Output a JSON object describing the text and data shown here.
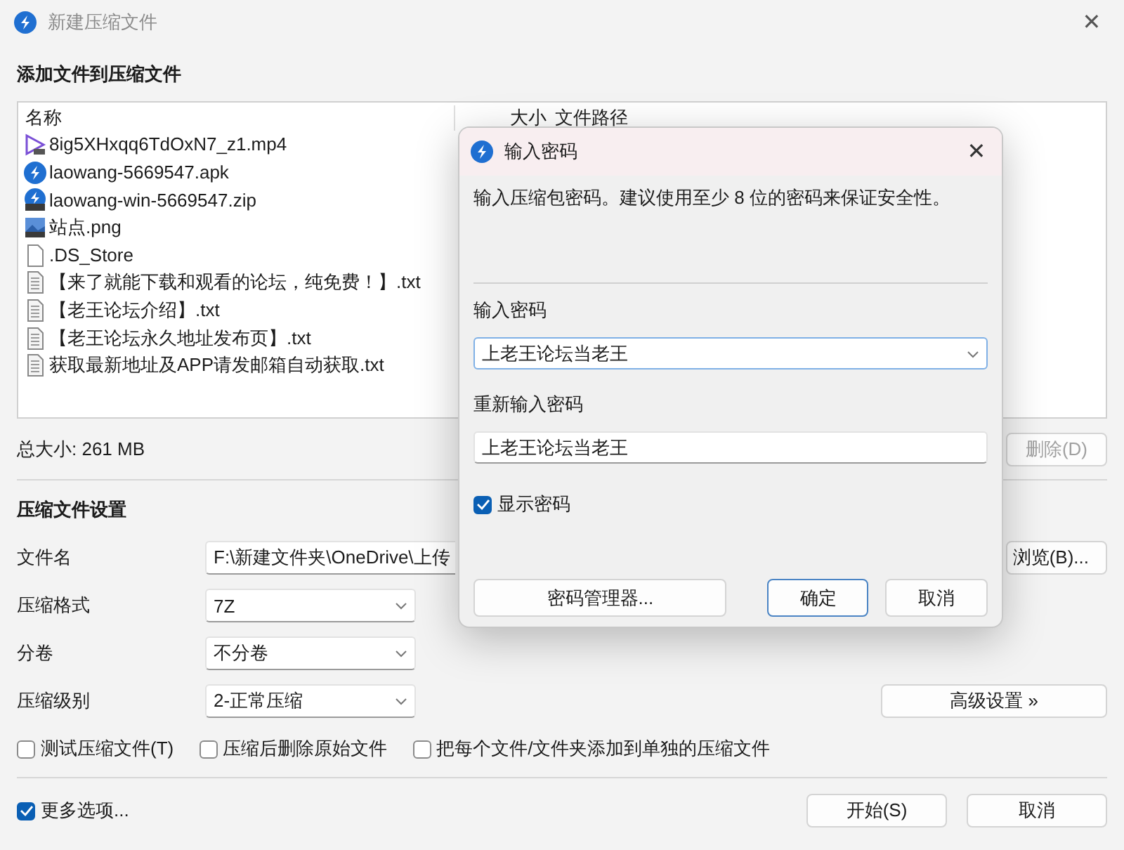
{
  "window": {
    "title": "新建压缩文件",
    "close": "✕"
  },
  "add_section": {
    "heading": "添加文件到压缩文件"
  },
  "file_list": {
    "columns": [
      "名称",
      "大小",
      "文件路径"
    ],
    "rows": [
      {
        "name": "8ig5XHxqq6TdOxN7_z1.mp4",
        "kind": "video"
      },
      {
        "name": "laowang-5669547.apk",
        "kind": "app"
      },
      {
        "name": "laowang-win-5669547.zip",
        "kind": "archive"
      },
      {
        "name": "站点.png",
        "kind": "image"
      },
      {
        "name": ".DS_Store",
        "kind": "blank"
      },
      {
        "name": "【来了就能下载和观看的论坛，纯免费！】.txt",
        "kind": "text"
      },
      {
        "name": "【老王论坛介绍】.txt",
        "kind": "text"
      },
      {
        "name": "【老王论坛永久地址发布页】.txt",
        "kind": "text"
      },
      {
        "name": "获取最新地址及APP请发邮箱自动获取.txt",
        "kind": "text"
      }
    ]
  },
  "total_size": "总大小: 261 MB",
  "delete_button": {
    "label": "删除(D)",
    "disabled": true
  },
  "settings": {
    "heading": "压缩文件设置",
    "file_name": {
      "label": "文件名",
      "value": "F:\\新建文件夹\\OneDrive\\上传"
    },
    "browse_button": "浏览(B)...",
    "format": {
      "label": "压缩格式",
      "value": "7Z"
    },
    "split": {
      "label": "分卷",
      "value": "不分卷"
    },
    "level": {
      "label": "压缩级别",
      "value": "2-正常压缩"
    },
    "advanced_button": "高级设置 »",
    "options": [
      {
        "label": "测试压缩文件(T)",
        "checked": false
      },
      {
        "label": "压缩后删除原始文件",
        "checked": false
      },
      {
        "label": "把每个文件/文件夹添加到单独的压缩文件",
        "checked": false
      }
    ]
  },
  "more_options": {
    "label": "更多选项...",
    "checked": true
  },
  "buttons": [
    {
      "label": "开始(S)"
    },
    {
      "label": "取消"
    }
  ],
  "dialog": {
    "title": "输入密码",
    "close": "✕",
    "message": "输入压缩包密码。建议使用至少 8 位的密码来保证安全性。",
    "password": {
      "label": "输入密码",
      "value": "上老王论坛当老王"
    },
    "confirm": {
      "label": "重新输入密码",
      "value": "上老王论坛当老王"
    },
    "show_password": {
      "label": "显示密码",
      "checked": true
    },
    "buttons": [
      {
        "label": "密码管理器...",
        "default": false
      },
      {
        "label": "确定",
        "default": true
      },
      {
        "label": "取消",
        "default": false
      }
    ]
  }
}
